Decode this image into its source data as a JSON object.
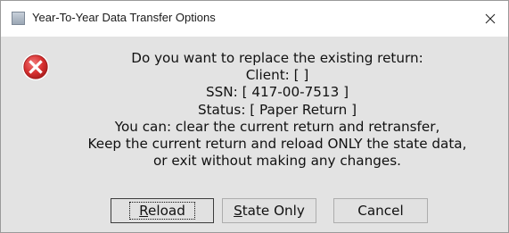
{
  "window": {
    "title": "Year-To-Year Data Transfer Options",
    "close_glyph": "✕"
  },
  "icons": {
    "app": "app-icon",
    "error": "error-icon",
    "close": "close-icon"
  },
  "message": {
    "lines": [
      "Do you want to replace the existing return:",
      "Client: [ ]",
      "SSN: [ 417-00-7513 ]",
      "Status: [ Paper Return ]",
      "You can: clear the current return and retransfer,",
      "Keep the current return and reload ONLY the state data,",
      "or exit without making any changes."
    ]
  },
  "buttons": {
    "reload": {
      "accel": "R",
      "rest": "eload"
    },
    "state_only": {
      "accel": "S",
      "rest": "tate Only"
    },
    "cancel": {
      "label": "Cancel"
    }
  },
  "colors": {
    "dialog_bg": "#e3e3e3",
    "titlebar_bg": "#ffffff",
    "error_red": "#d62f2f"
  }
}
